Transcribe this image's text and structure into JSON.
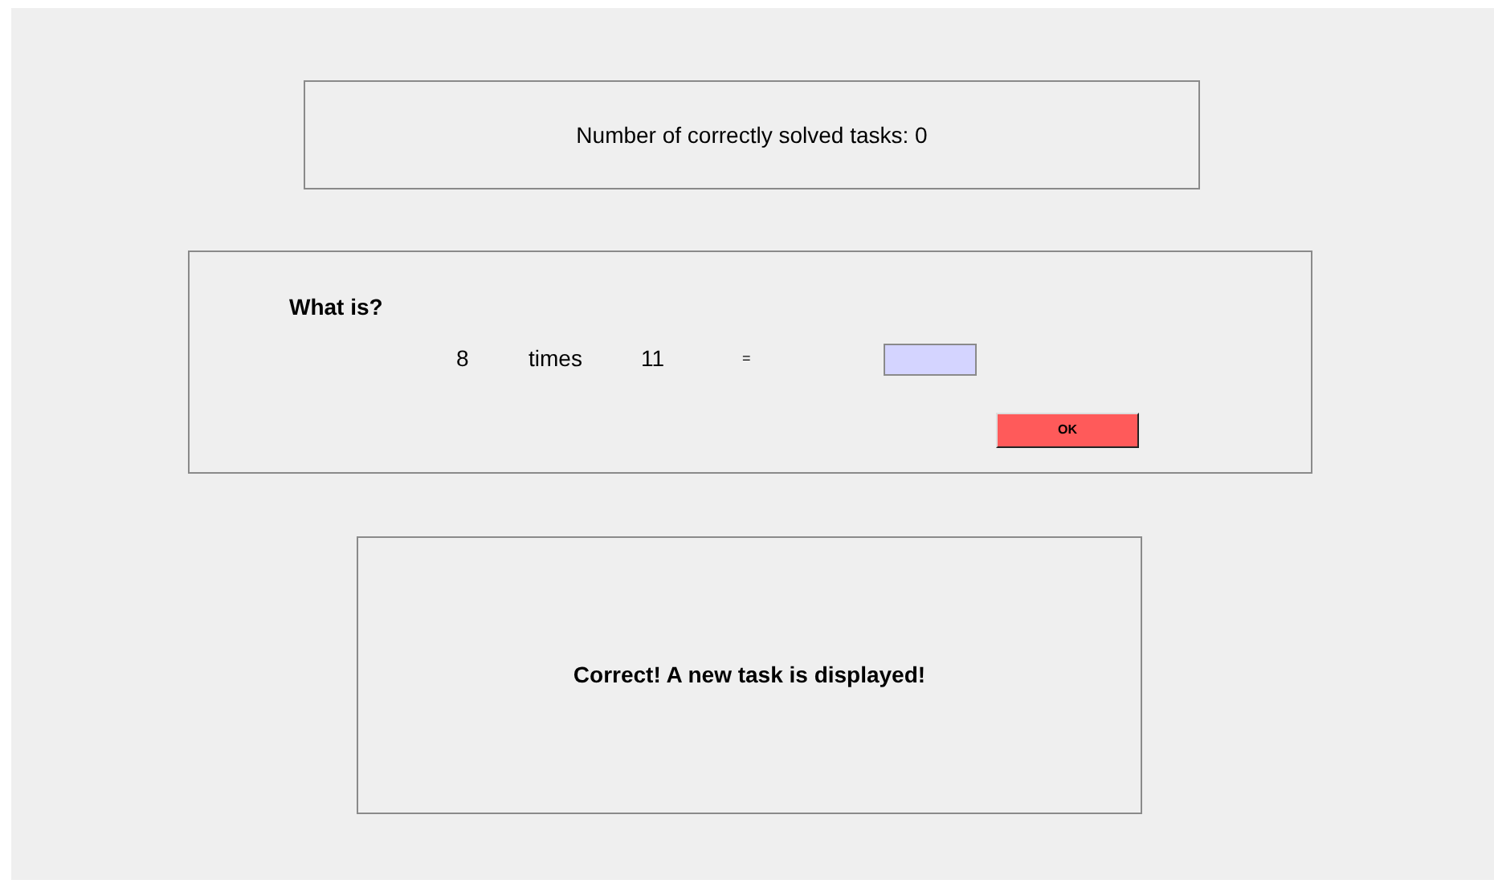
{
  "score_panel": {
    "text": "Number of correctly solved tasks: 0"
  },
  "task_panel": {
    "heading": "What is?",
    "operand_1": "8",
    "operator": "times",
    "operand_2": "11",
    "equals": "=",
    "answer_field": {
      "kind": "input"
    },
    "submit_button": "OK"
  },
  "feedback_panel": {
    "message": "Correct! A new task is displayed!"
  }
}
